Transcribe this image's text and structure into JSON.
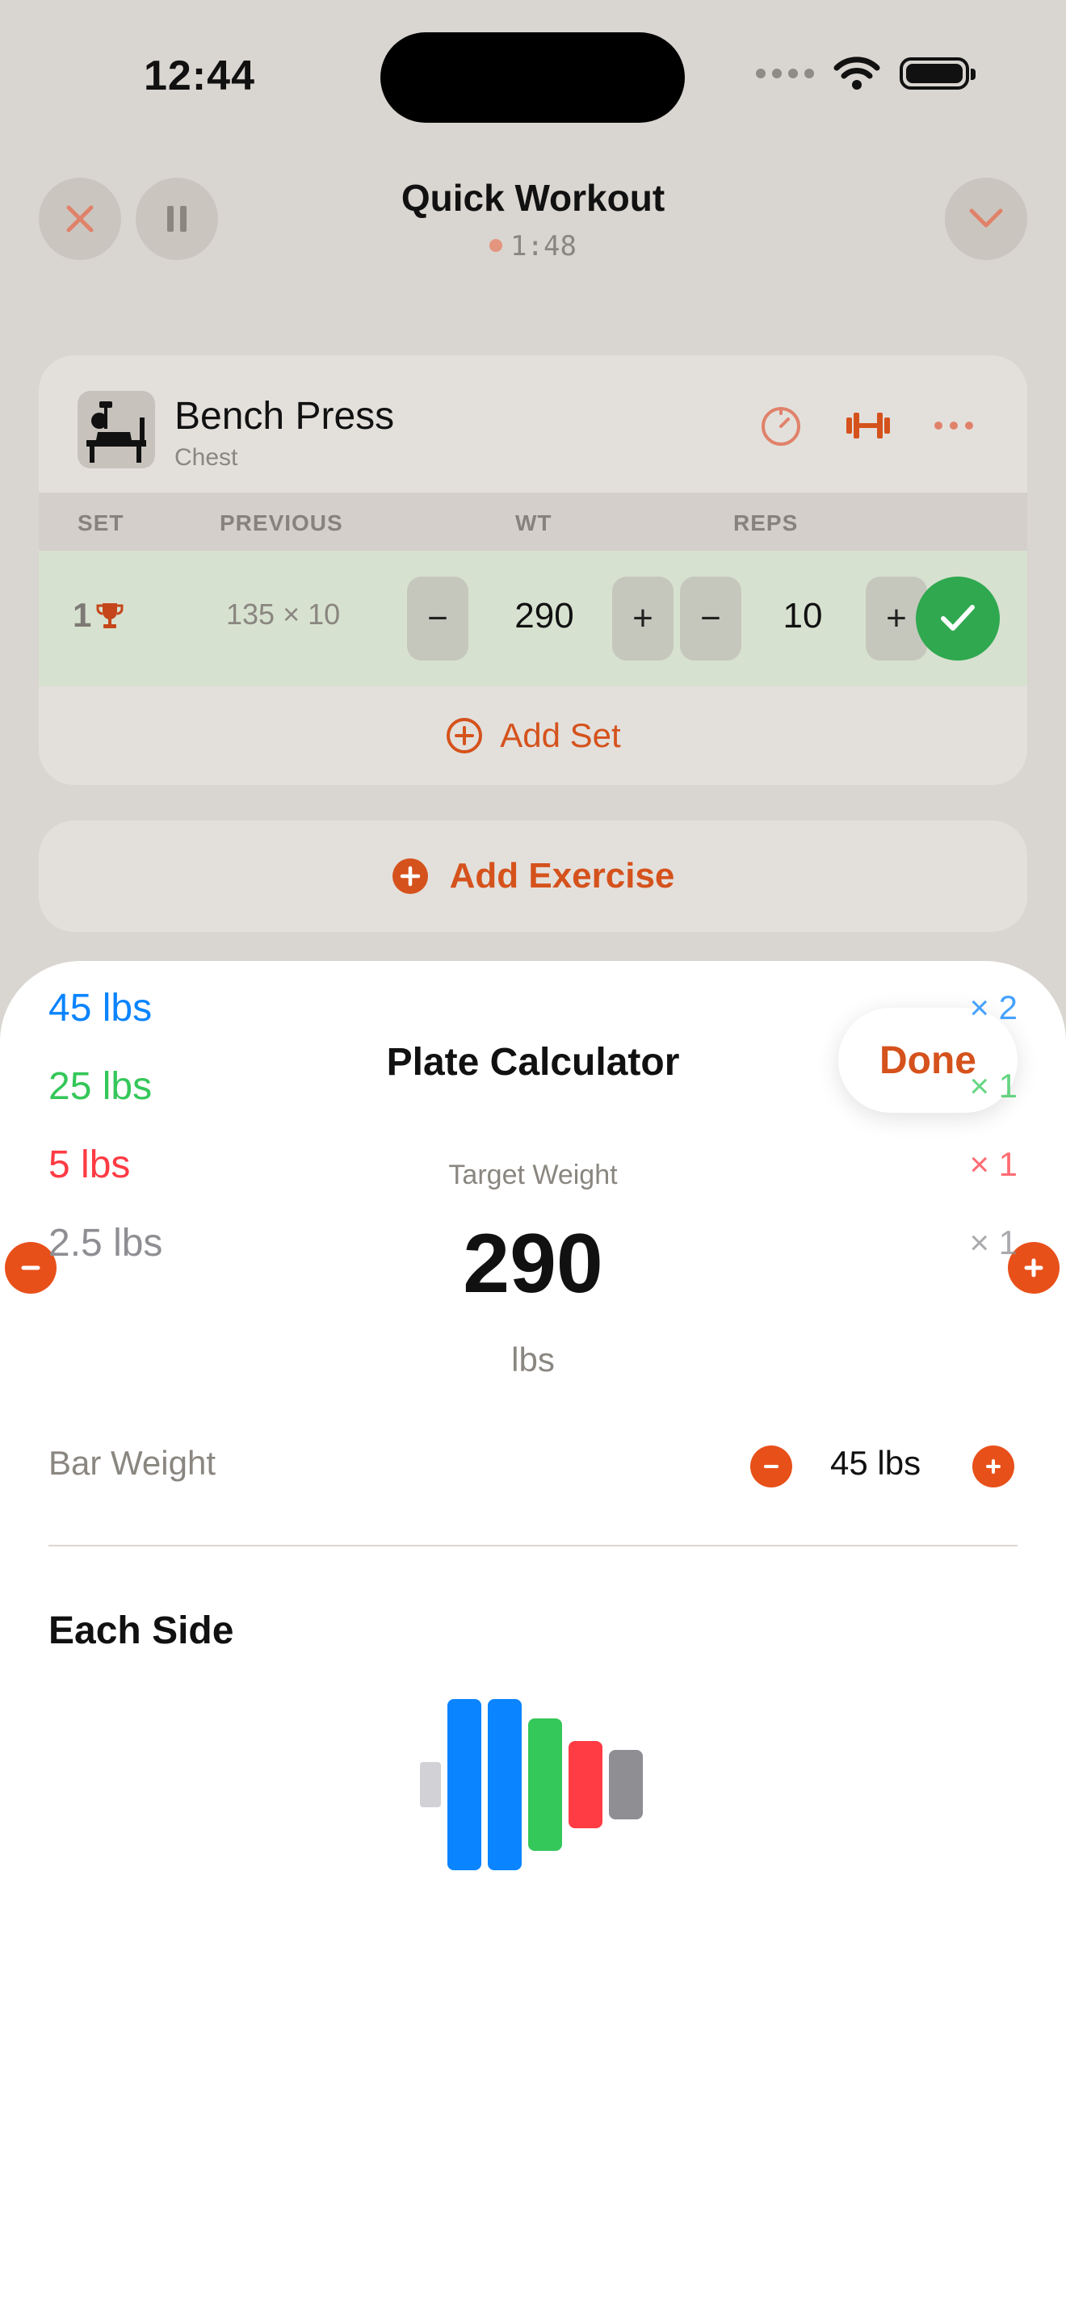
{
  "status_bar": {
    "time": "12:44"
  },
  "header": {
    "title": "Quick Workout",
    "timer": "1:48"
  },
  "exercise": {
    "name": "Bench Press",
    "muscle": "Chest",
    "columns": {
      "set": "SET",
      "previous": "PREVIOUS",
      "weight": "WT",
      "reps": "REPS"
    },
    "sets": [
      {
        "number": "1",
        "previous": "135 × 10",
        "weight": "290",
        "reps": "10",
        "completed": true,
        "pr": true
      }
    ],
    "add_set_label": "Add Set"
  },
  "add_exercise_label": "Add Exercise",
  "plate_calculator": {
    "title": "Plate Calculator",
    "done_label": "Done",
    "target_label": "Target Weight",
    "target_value": "290",
    "target_unit": "lbs",
    "bar_weight_label": "Bar Weight",
    "bar_weight_value": "45 lbs",
    "each_side_label": "Each Side",
    "plates": [
      {
        "weight": "45 lbs",
        "count": "× 2",
        "color": "#0a84ff"
      },
      {
        "weight": "25 lbs",
        "count": "× 1",
        "color": "#34c759"
      },
      {
        "weight": "5 lbs",
        "count": "× 1",
        "color": "#ff3b43"
      },
      {
        "weight": "2.5 lbs",
        "count": "× 1",
        "color": "#8e8e93"
      }
    ]
  },
  "colors": {
    "accent": "#d5521c",
    "accent_button": "#e8501a",
    "success": "#2fa84f",
    "background": "#d9d5d0",
    "card": "#e3e0dc",
    "completed_row": "#d7e1d0",
    "bar_sleeve": "#d1d1d6"
  }
}
